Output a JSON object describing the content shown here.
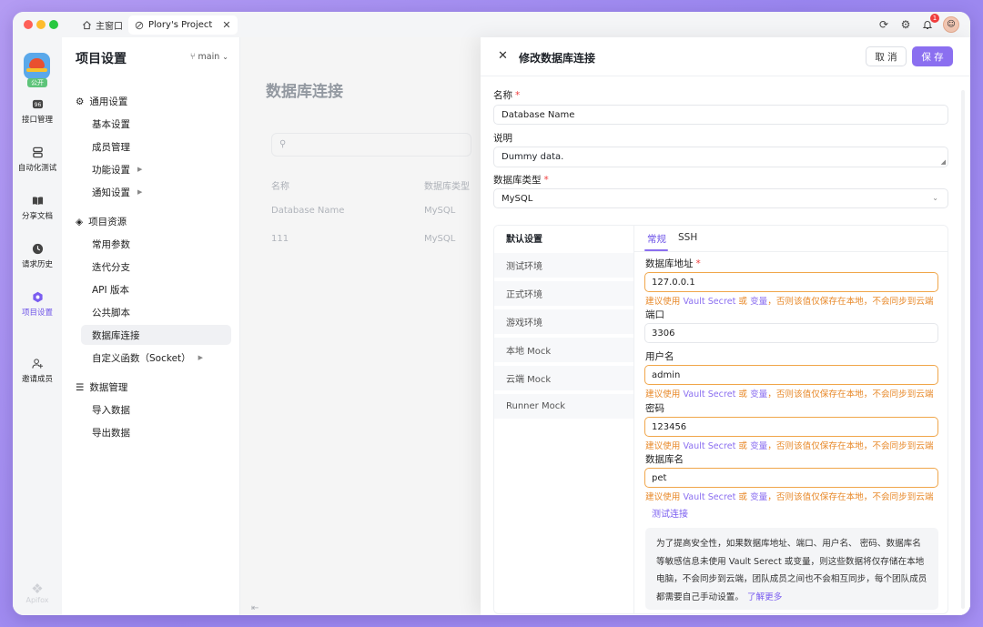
{
  "tabs": {
    "home": "主窗口",
    "project": "Plory's Project"
  },
  "notification_count": "1",
  "rail": {
    "badge": "公开",
    "items": [
      "接口管理",
      "自动化测试",
      "分享文档",
      "请求历史",
      "项目设置",
      "邀请成员"
    ],
    "brand": "Apifox"
  },
  "sidebar": {
    "title": "项目设置",
    "branch": "main",
    "group_general": "通用设置",
    "general_items": [
      "基本设置",
      "成员管理",
      "功能设置",
      "通知设置"
    ],
    "group_resources": "项目资源",
    "resource_items": [
      "常用参数",
      "迭代分支",
      "API 版本",
      "公共脚本",
      "数据库连接",
      "自定义函数（Socket）"
    ],
    "group_data": "数据管理",
    "data_items": [
      "导入数据",
      "导出数据"
    ]
  },
  "content": {
    "title": "数据库连接",
    "col_name": "名称",
    "col_type": "数据库类型",
    "rows": [
      {
        "name": "Database Name",
        "type": "MySQL"
      },
      {
        "name": "111",
        "type": "MySQL"
      }
    ]
  },
  "drawer": {
    "title": "修改数据库连接",
    "cancel": "取 消",
    "save": "保 存",
    "name_label": "名称",
    "name_value": "Database Name",
    "desc_label": "说明",
    "desc_value": "Dummy data.",
    "type_label": "数据库类型",
    "type_value": "MySQL",
    "envs": [
      "默认设置",
      "测试环境",
      "正式环境",
      "游戏环境",
      "本地 Mock",
      "云端 Mock",
      "Runner Mock"
    ],
    "sub_tabs": [
      "常规",
      "SSH"
    ],
    "host_label": "数据库地址",
    "host_value": "127.0.0.1",
    "port_label": "端口",
    "port_value": "3306",
    "user_label": "用户名",
    "user_value": "admin",
    "pass_label": "密码",
    "pass_value": "123456",
    "db_label": "数据库名",
    "db_value": "pet",
    "hint_pre": "建议使用 ",
    "hint_vault": "Vault Secret",
    "hint_or": " 或 ",
    "hint_var": "变量",
    "hint_post": "，否则该值仅保存在本地，不会同步到云端",
    "test_link": "测试连接",
    "note": "为了提高安全性，如果数据库地址、端口、用户名、 密码、数据库名等敏感信息未使用 Vault Serect 或变量，则这些数据将仅存储在本地电脑，不会同步到云端，团队成员之间也不会相互同步，每个团队成员都需要自己手动设置。",
    "note_link": "了解更多"
  }
}
